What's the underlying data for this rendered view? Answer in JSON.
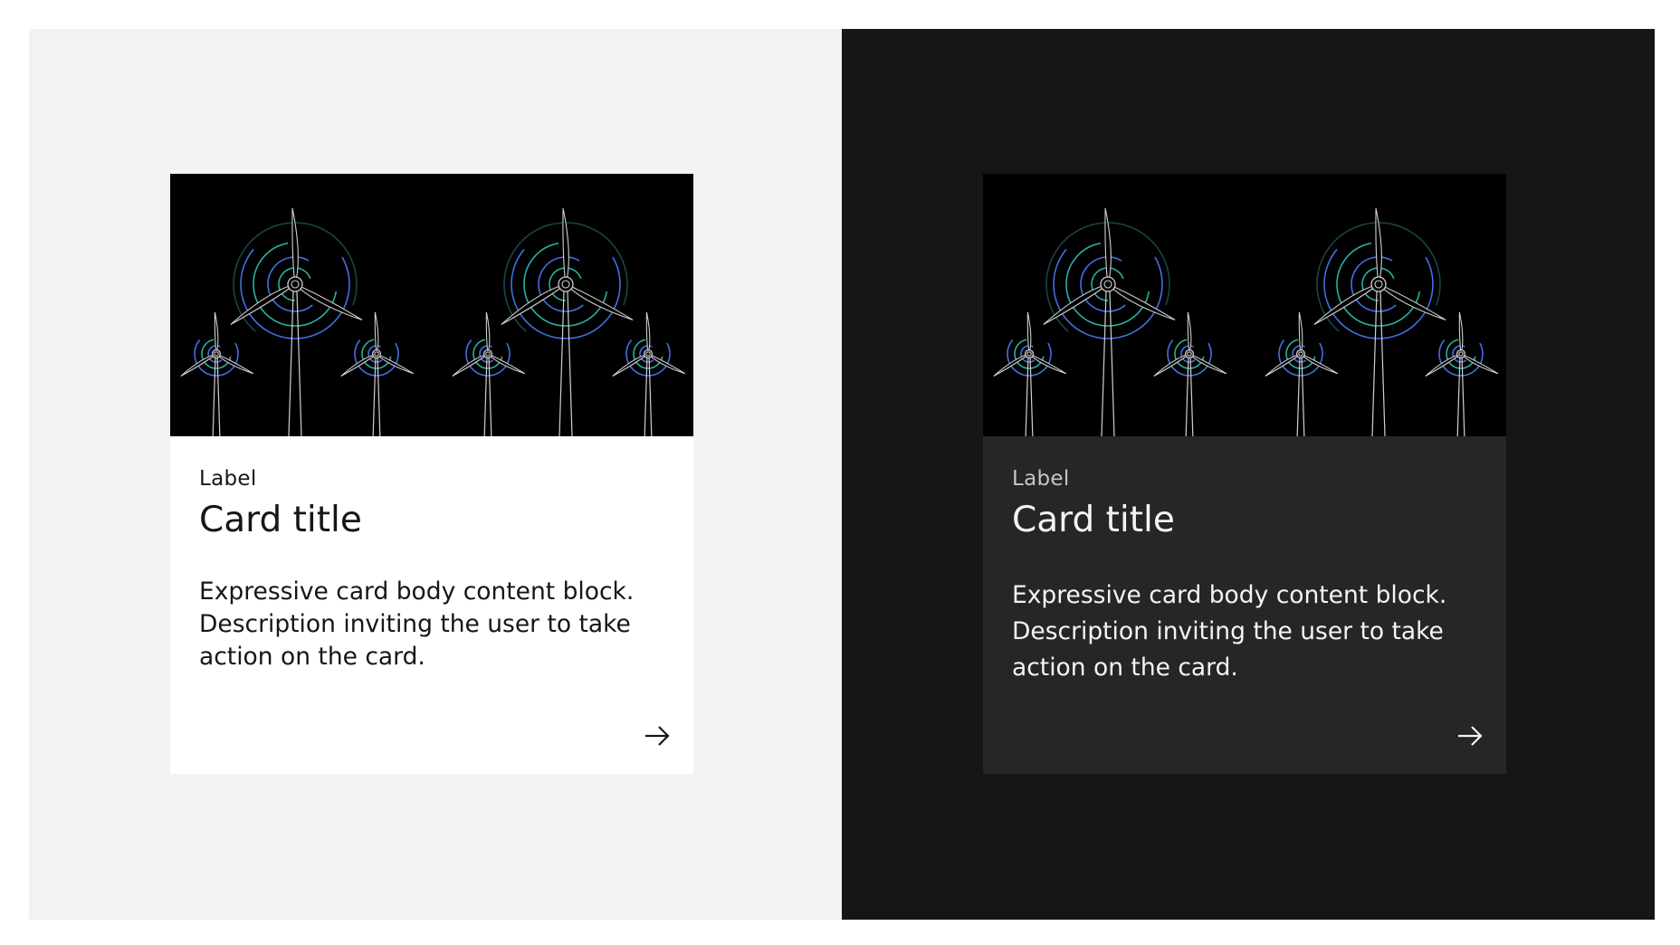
{
  "theme_light": {
    "card": {
      "label": "Label",
      "title": "Card title",
      "body": "Expressive card body content block. Description inviting the user to take action on the card.",
      "arrow_icon": "arrow-right-icon",
      "media_icon": "wind-turbines-illustration"
    },
    "colors": {
      "panel_bg": "#f2f2f2",
      "card_bg": "#ffffff",
      "text": "#161616"
    }
  },
  "theme_dark": {
    "card": {
      "label": "Label",
      "title": "Card title",
      "body": "Expressive card body content block. Description inviting the user to take action on the card.",
      "arrow_icon": "arrow-right-icon",
      "media_icon": "wind-turbines-illustration"
    },
    "colors": {
      "panel_bg": "#161616",
      "card_bg": "#262626",
      "text": "#f4f4f4"
    }
  }
}
